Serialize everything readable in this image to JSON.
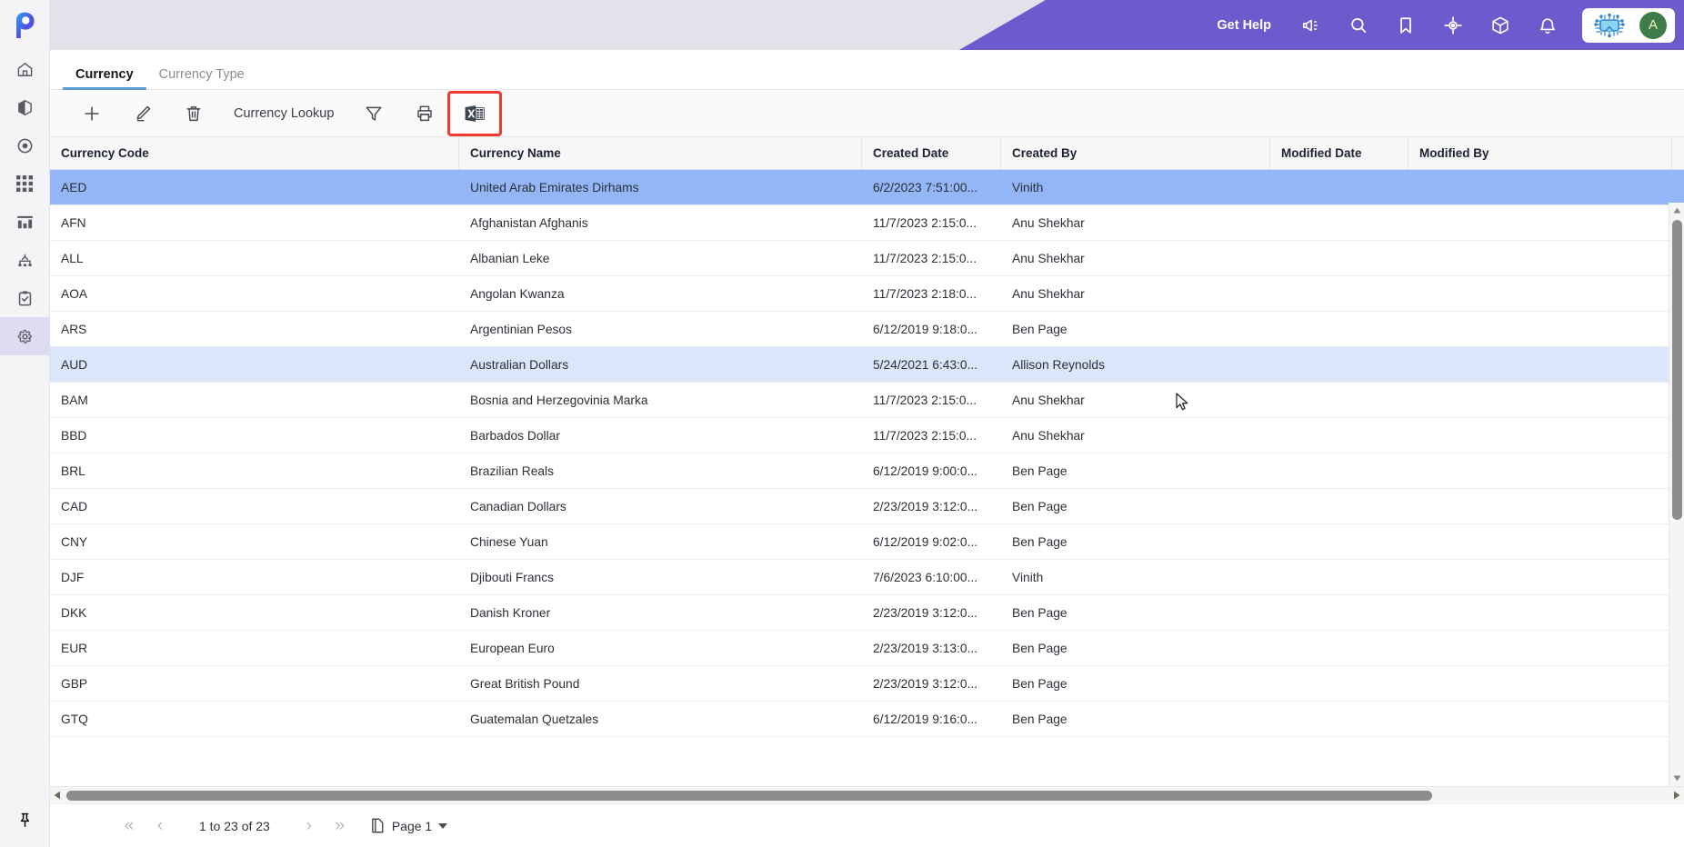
{
  "app": {
    "logo_icon": "priority-p-logo"
  },
  "sidebar": {
    "items": [
      {
        "name": "home",
        "icon": "home-icon"
      },
      {
        "name": "products",
        "icon": "box-icon"
      },
      {
        "name": "target",
        "icon": "target-circle-icon"
      },
      {
        "name": "apps",
        "icon": "grid-apps-icon"
      },
      {
        "name": "reports",
        "icon": "bar-chart-icon"
      },
      {
        "name": "hierarchy",
        "icon": "hierarchy-icon"
      },
      {
        "name": "tasks",
        "icon": "clipboard-check-icon"
      },
      {
        "name": "settings",
        "icon": "gear-icon",
        "active": true
      }
    ],
    "pin": {
      "name": "pin",
      "icon": "pushpin-icon"
    }
  },
  "topbar": {
    "get_help": "Get Help",
    "icons": [
      {
        "name": "announcements",
        "icon": "megaphone-icon"
      },
      {
        "name": "search",
        "icon": "search-icon"
      },
      {
        "name": "bookmarks",
        "icon": "bookmark-icon"
      },
      {
        "name": "locate",
        "icon": "crosshair-icon"
      },
      {
        "name": "apps-cube",
        "icon": "cube-icon"
      },
      {
        "name": "notifications",
        "icon": "bell-icon"
      }
    ],
    "user": {
      "chip_icon": "ai-chip-icon",
      "avatar_initial": "A",
      "avatar_color": "#3e7d4a"
    },
    "accent_color": "#6c5bcc",
    "background_color": "#e4e1ea"
  },
  "tabs": [
    {
      "label": "Currency",
      "active": true
    },
    {
      "label": "Currency Type",
      "active": false
    }
  ],
  "toolbar": {
    "items": [
      {
        "name": "add",
        "icon": "plus-icon",
        "type": "icon"
      },
      {
        "name": "edit",
        "icon": "pencil-icon",
        "type": "icon"
      },
      {
        "name": "delete",
        "icon": "trash-icon",
        "type": "icon"
      },
      {
        "name": "currency-lookup",
        "label": "Currency Lookup",
        "type": "text"
      },
      {
        "name": "filter",
        "icon": "funnel-icon",
        "type": "icon"
      },
      {
        "name": "print",
        "icon": "printer-icon",
        "type": "icon"
      },
      {
        "name": "export-excel",
        "icon": "excel-icon",
        "type": "icon",
        "highlighted": true
      }
    ],
    "highlight_color": "#ef3b31"
  },
  "grid": {
    "columns": [
      "Currency Code",
      "Currency Name",
      "Created Date",
      "Created By",
      "Modified Date",
      "Modified By"
    ],
    "rows": [
      {
        "code": "AED",
        "name": "United Arab Emirates Dirhams",
        "created_date": "6/2/2023 7:51:00...",
        "created_by": "Vinith",
        "modified_date": "",
        "modified_by": "",
        "state": "selected"
      },
      {
        "code": "AFN",
        "name": "Afghanistan Afghanis",
        "created_date": "11/7/2023 2:15:0...",
        "created_by": "Anu Shekhar",
        "modified_date": "",
        "modified_by": "",
        "state": ""
      },
      {
        "code": "ALL",
        "name": "Albanian Leke",
        "created_date": "11/7/2023 2:15:0...",
        "created_by": "Anu Shekhar",
        "modified_date": "",
        "modified_by": "",
        "state": ""
      },
      {
        "code": "AOA",
        "name": "Angolan Kwanza",
        "created_date": "11/7/2023 2:18:0...",
        "created_by": "Anu Shekhar",
        "modified_date": "",
        "modified_by": "",
        "state": ""
      },
      {
        "code": "ARS",
        "name": "Argentinian Pesos",
        "created_date": "6/12/2019 9:18:0...",
        "created_by": "Ben Page",
        "modified_date": "",
        "modified_by": "",
        "state": ""
      },
      {
        "code": "AUD",
        "name": "Australian Dollars",
        "created_date": "5/24/2021 6:43:0...",
        "created_by": "Allison Reynolds",
        "modified_date": "",
        "modified_by": "",
        "state": "hover"
      },
      {
        "code": "BAM",
        "name": "Bosnia and Herzegovinia Marka",
        "created_date": "11/7/2023 2:15:0...",
        "created_by": "Anu Shekhar",
        "modified_date": "",
        "modified_by": "",
        "state": ""
      },
      {
        "code": "BBD",
        "name": "Barbados Dollar",
        "created_date": "11/7/2023 2:15:0...",
        "created_by": "Anu Shekhar",
        "modified_date": "",
        "modified_by": "",
        "state": ""
      },
      {
        "code": "BRL",
        "name": "Brazilian Reals",
        "created_date": "6/12/2019 9:00:0...",
        "created_by": "Ben Page",
        "modified_date": "",
        "modified_by": "",
        "state": ""
      },
      {
        "code": "CAD",
        "name": "Canadian Dollars",
        "created_date": "2/23/2019 3:12:0...",
        "created_by": "Ben Page",
        "modified_date": "",
        "modified_by": "",
        "state": ""
      },
      {
        "code": "CNY",
        "name": "Chinese Yuan",
        "created_date": "6/12/2019 9:02:0...",
        "created_by": "Ben Page",
        "modified_date": "",
        "modified_by": "",
        "state": ""
      },
      {
        "code": "DJF",
        "name": "Djibouti Francs",
        "created_date": "7/6/2023 6:10:00...",
        "created_by": "Vinith",
        "modified_date": "",
        "modified_by": "",
        "state": ""
      },
      {
        "code": "DKK",
        "name": "Danish Kroner",
        "created_date": "2/23/2019 3:12:0...",
        "created_by": "Ben Page",
        "modified_date": "",
        "modified_by": "",
        "state": ""
      },
      {
        "code": "EUR",
        "name": "European Euro",
        "created_date": "2/23/2019 3:13:0...",
        "created_by": "Ben Page",
        "modified_date": "",
        "modified_by": "",
        "state": ""
      },
      {
        "code": "GBP",
        "name": "Great British Pound",
        "created_date": "2/23/2019 3:12:0...",
        "created_by": "Ben Page",
        "modified_date": "",
        "modified_by": "",
        "state": ""
      },
      {
        "code": "GTQ",
        "name": "Guatemalan Quetzales",
        "created_date": "6/12/2019 9:16:0...",
        "created_by": "Ben Page",
        "modified_date": "",
        "modified_by": "",
        "state": ""
      }
    ],
    "selected_row_color": "#93b6f7",
    "hover_row_color": "#dbe6fb"
  },
  "pager": {
    "first_label": "«",
    "prev_label": "‹",
    "count_label": "1 to 23 of 23",
    "next_label": "›",
    "last_label": "»",
    "page_icon": "pages-icon",
    "page_label": "Page 1"
  }
}
